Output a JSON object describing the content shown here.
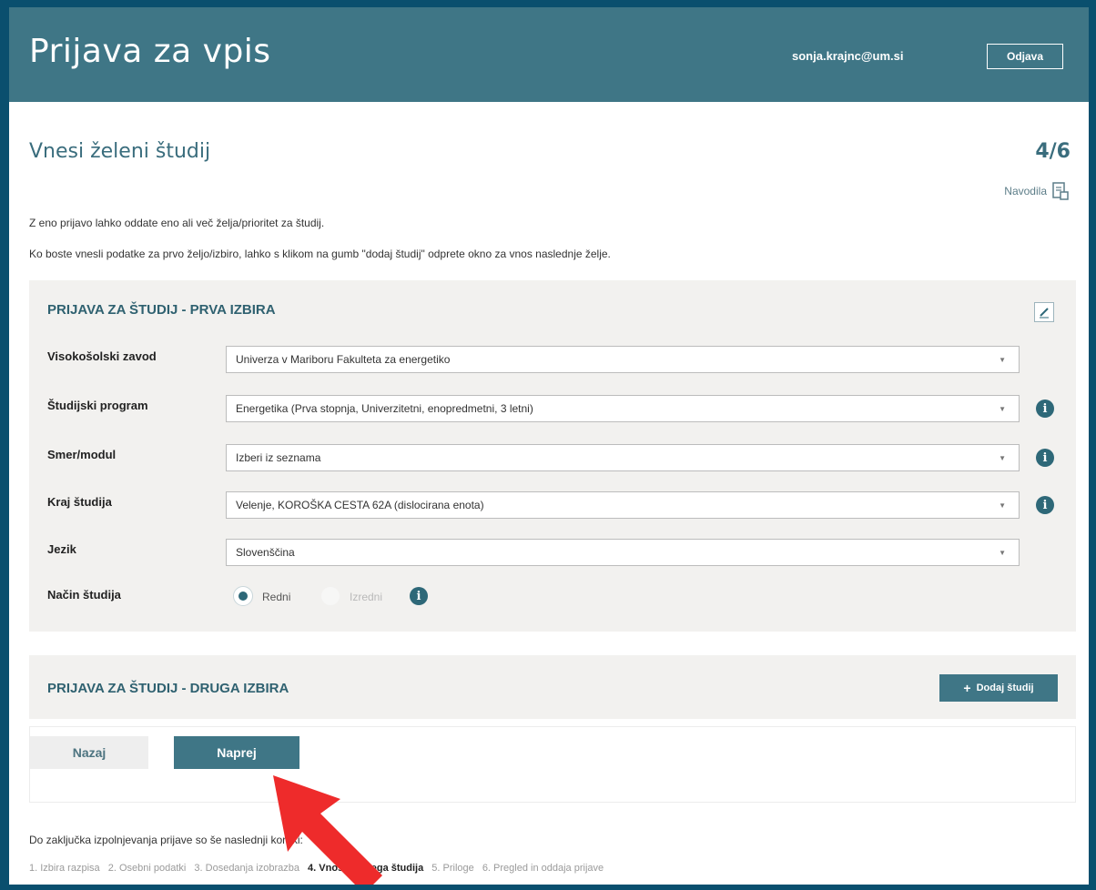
{
  "header": {
    "title": "Prijava za vpis",
    "user_email": "sonja.krajnc@um.si",
    "logout_label": "Odjava"
  },
  "page": {
    "title": "Vnesi želeni študij",
    "step": "4/6",
    "help_label": "Navodila",
    "help_icon": "document-icon",
    "intro_1": "Z eno prijavo lahko oddate eno ali več želja/prioritet za študij.",
    "intro_2": "Ko boste vnesli podatke za prvo željo/izbiro, lahko s klikom na gumb \"dodaj študij\" odprete okno za vnos naslednje želje."
  },
  "first_choice": {
    "title": "PRIJAVA ZA ŠTUDIJ - PRVA IZBIRA",
    "fields": [
      {
        "label": "Visokošolski zavod",
        "value": "Univerza v Mariboru Fakulteta za energetiko"
      },
      {
        "label": "Študijski program",
        "value": "Energetika (Prva stopnja, Univerzitetni, enopredmetni, 3 letni)"
      },
      {
        "label": "Smer/modul",
        "value": "Izberi iz seznama"
      },
      {
        "label": "Kraj študija",
        "value": "Velenje, KOROŠKA CESTA 62A (dislocirana enota)"
      },
      {
        "label": "Jezik",
        "value": "Slovenščina"
      }
    ],
    "mode": {
      "label": "Način študija",
      "option_1": "Redni",
      "option_2": "Izredni",
      "selected": "Redni"
    }
  },
  "second_choice": {
    "title": "PRIJAVA ZA ŠTUDIJ - DRUGA IZBIRA",
    "add_label": "Dodaj študij"
  },
  "nav": {
    "back_label": "Nazaj",
    "next_label": "Naprej"
  },
  "footer": {
    "note": "Do zaključka izpolnjevanja prijave so še naslednji koraki:",
    "steps": [
      "1. Izbira razpisa",
      "2. Osebni podatki",
      "3. Dosedanja izobrazba",
      "4. Vnos želenega študija",
      "5. Priloge",
      "6. Pregled in oddaja prijave"
    ],
    "active_step": "4. Vnos želenega študija"
  },
  "colors": {
    "header": "#3f7686",
    "accent": "#2e6878",
    "arrow": "#ee2b2b"
  }
}
